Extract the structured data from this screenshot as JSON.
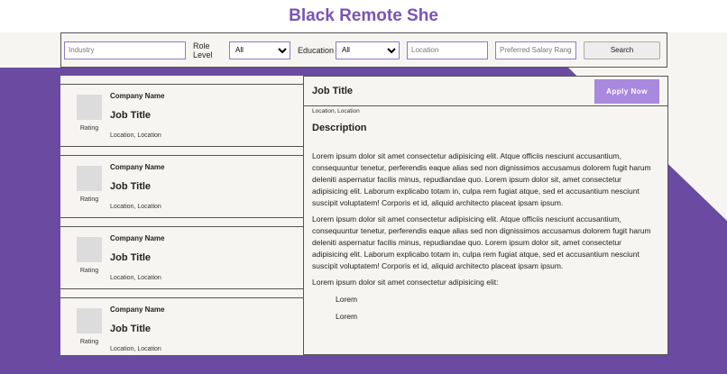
{
  "brand": {
    "title": "Black Remote She"
  },
  "search": {
    "industry_placeholder": "Industry",
    "role_level_label": "Role Level",
    "role_level_value": "All",
    "education_label": "Education",
    "education_value": "All",
    "location_placeholder": "Location",
    "salary_placeholder": "Preferred Salary Range",
    "search_button": "Search"
  },
  "jobs": [
    {
      "company": "Company Name",
      "title": "Job Title",
      "rating": "Rating",
      "location": "Location, Location"
    },
    {
      "company": "Company Name",
      "title": "Job Title",
      "rating": "Rating",
      "location": "Location, Location"
    },
    {
      "company": "Company Name",
      "title": "Job Title",
      "rating": "Rating",
      "location": "Location, Location"
    },
    {
      "company": "Company Name",
      "title": "Job Title",
      "rating": "Rating",
      "location": "Location, Location"
    }
  ],
  "detail": {
    "title": "Job Title",
    "apply_button": "Apply Now",
    "location": "Location, Location",
    "description_heading": "Description",
    "paragraph_1": "Lorem ipsum dolor sit amet consectetur adipisicing elit. Atque officiis nesciunt accusantium, consequuntur tenetur, perferendis eaque alias sed non dignissimos accusamus dolorem fugit harum deleniti aspernatur facilis minus, repudiandae quo. Lorem ipsum dolor sit, amet consectetur adipisicing elit. Laborum explicabo totam in, culpa rem fugiat atque, sed et accusantium nesciunt suscipit voluptatem! Corporis et id, aliquid architecto placeat ipsam ipsum.",
    "paragraph_2": "Lorem ipsum dolor sit amet consectetur adipisicing elit. Atque officiis nesciunt accusantium, consequuntur tenetur, perferendis eaque alias sed non dignissimos accusamus dolorem fugit harum deleniti aspernatur facilis minus, repudiandae quo. Lorem ipsum dolor sit, amet consectetur adipisicing elit. Laborum explicabo totam in, culpa rem fugiat atque, sed et accusantium nesciunt suscipit voluptatem! Corporis et id, aliquid architecto placeat ipsam ipsum.",
    "paragraph_3": "Lorem ipsum dolor sit amet consectetur adipisicing elit:",
    "list_items": [
      "Lorem",
      "Lorem"
    ]
  },
  "colors": {
    "brand": "#7954b4",
    "background_accent": "#6a4ba1",
    "apply_button": "#a989dd"
  }
}
